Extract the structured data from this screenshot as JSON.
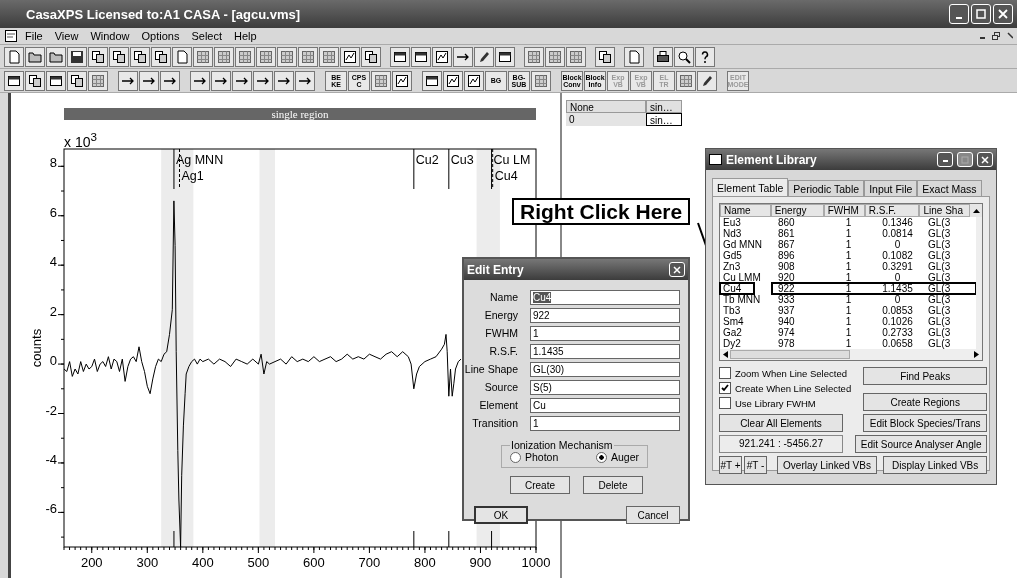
{
  "window": {
    "title": "CasaXPS Licensed to:A1 CASA - [agcu.vms]"
  },
  "menu": [
    "File",
    "View",
    "Window",
    "Options",
    "Select",
    "Help"
  ],
  "toolbar_2": [
    {
      "kind": "icon"
    },
    {
      "kind": "icon"
    },
    {
      "kind": "icon"
    },
    {
      "kind": "icon"
    },
    {
      "kind": "icon"
    },
    {
      "kind": "gap"
    },
    {
      "kind": "icon"
    },
    {
      "kind": "icon"
    },
    {
      "kind": "icon"
    },
    {
      "kind": "gap"
    },
    {
      "kind": "icon"
    },
    {
      "kind": "icon"
    },
    {
      "kind": "icon"
    },
    {
      "kind": "icon"
    },
    {
      "kind": "icon"
    },
    {
      "kind": "icon"
    },
    {
      "kind": "gap"
    },
    {
      "kind": "text",
      "label": "BE KE",
      "disabled": false
    },
    {
      "kind": "text",
      "label": "CPS C",
      "disabled": false
    },
    {
      "kind": "icon"
    },
    {
      "kind": "icon"
    },
    {
      "kind": "gap"
    },
    {
      "kind": "icon"
    },
    {
      "kind": "icon"
    },
    {
      "kind": "icon"
    },
    {
      "kind": "text",
      "label": "BG",
      "disabled": false
    },
    {
      "kind": "text",
      "label": "BG- SUB",
      "disabled": false
    },
    {
      "kind": "icon"
    },
    {
      "kind": "gap"
    },
    {
      "kind": "text",
      "label": "Block Conv",
      "disabled": false
    },
    {
      "kind": "text",
      "label": "Block Info",
      "disabled": false
    },
    {
      "kind": "text",
      "label": "Exp VB",
      "disabled": true
    },
    {
      "kind": "text",
      "label": "Exp VB",
      "disabled": true
    },
    {
      "kind": "text",
      "label": "EL TR",
      "disabled": true
    },
    {
      "kind": "icon"
    },
    {
      "kind": "icon"
    },
    {
      "kind": "gap"
    },
    {
      "kind": "text",
      "label": "EDIT MODE",
      "disabled": true
    }
  ],
  "plot": {
    "banner": "single region",
    "scale_label": "x 10$^{3}$",
    "chart_data": {
      "type": "line",
      "ylabel": "counts",
      "xlim": [
        150,
        1000
      ],
      "ylim": [
        -7.4,
        8.7
      ],
      "xticks": [
        200,
        300,
        400,
        500,
        600,
        700,
        800,
        900,
        1000
      ],
      "yticks": [
        8,
        6,
        4,
        2,
        0,
        -2,
        -4,
        -6
      ],
      "x": [
        150,
        155,
        160,
        165,
        170,
        175,
        180,
        185,
        190,
        195,
        200,
        205,
        210,
        215,
        220,
        225,
        230,
        235,
        240,
        245,
        250,
        255,
        260,
        265,
        270,
        275,
        280,
        285,
        290,
        295,
        300,
        305,
        310,
        315,
        320,
        325,
        330,
        335,
        340,
        345,
        348,
        350,
        352,
        355,
        357,
        360,
        362,
        365,
        368,
        370,
        375,
        380,
        385,
        390,
        395,
        400,
        410,
        420,
        430,
        440,
        450,
        460,
        470,
        480,
        490,
        500,
        505,
        510,
        515,
        520,
        530,
        540,
        550,
        560,
        570,
        580,
        590,
        600,
        610,
        620,
        630,
        640,
        650,
        660,
        670,
        680,
        690,
        700,
        710,
        720,
        730,
        740,
        750,
        760,
        770,
        775,
        780,
        785,
        790,
        800,
        810,
        820,
        830,
        835,
        838,
        840,
        843,
        846,
        849,
        852,
        855,
        860,
        865
      ],
      "series": [
        {
          "color": "#000000",
          "values": [
            -0.2,
            -0.3,
            0.1,
            -0.5,
            -0.2,
            -0.4,
            0.1,
            -0.3,
            0,
            -0.2,
            -0.1,
            0.2,
            -0.3,
            0,
            0.1,
            -0.1,
            0.3,
            -0.2,
            0.2,
            0.1,
            -0.3,
            0.2,
            -0.7,
            -0.1,
            0.2,
            0.3,
            0.1,
            0.7,
            0.1,
            -0.3,
            -0.9,
            -1.2,
            -0.6,
            -0.1,
            0.2,
            0.1,
            0.4,
            0.5,
            1.2,
            2.2,
            6.6,
            4.8,
            0.5,
            -3.5,
            -5.5,
            -7.4,
            -4.5,
            -2.5,
            -1.2,
            -0.4,
            -0.1,
            0.1,
            0.2,
            0,
            0.2,
            0.1,
            0.2,
            0,
            0.2,
            0.1,
            -0.1,
            0.2,
            0.1,
            0,
            0.2,
            0,
            0.4,
            -0.4,
            0.1,
            0,
            0.1,
            0.2,
            0,
            0.3,
            0.1,
            0.2,
            0.1,
            0.3,
            0.1,
            0.2,
            0.3,
            0.1,
            0.2,
            0.4,
            0.2,
            0.3,
            0.2,
            0.4,
            0.3,
            0.2,
            0.4,
            0.5,
            0.3,
            0.5,
            0.3,
            0,
            -1,
            -0.4,
            -0.1,
            0.1,
            0.2,
            0.3,
            0.6,
            0.8,
            1.2,
            0.5,
            -1.3,
            -0.2,
            -1.3,
            -0.8,
            -0.2,
            0.1,
            0.2
          ]
        }
      ],
      "ref_lines": [
        {
          "axis": "x",
          "value": 348,
          "label": "Ag MNN"
        },
        {
          "axis": "x",
          "value": 358,
          "label": "Ag1"
        },
        {
          "axis": "x",
          "value": 780,
          "label": "Cu2"
        },
        {
          "axis": "x",
          "value": 843,
          "label": "Cu3"
        },
        {
          "axis": "x",
          "value": 920,
          "label": "Cu LM"
        },
        {
          "axis": "x",
          "value": 922,
          "label": "Cu4"
        }
      ]
    }
  },
  "region_table": {
    "columns": [
      "None",
      "sin…"
    ],
    "rows": [
      {
        "cells": [
          {
            "text": "0",
            "focused": false
          },
          {
            "text": "sin…",
            "focused": true
          }
        ]
      }
    ]
  },
  "annotation": {
    "text": "Right Click Here"
  },
  "element_library": {
    "title": "Element Library",
    "tabs": [
      {
        "label": "Element Table",
        "selected": true
      },
      {
        "label": "Periodic Table",
        "selected": false
      },
      {
        "label": "Input File",
        "selected": false
      },
      {
        "label": "Exact Mass",
        "selected": false
      }
    ],
    "columns": [
      "Name",
      "Energy",
      "FWHM",
      "R.S.F.",
      "Line Sha"
    ],
    "rows": [
      {
        "cells": [
          "Eu3",
          "860",
          "1",
          "0.1346",
          "GL(3"
        ],
        "callout": false
      },
      {
        "cells": [
          "Nd3",
          "861",
          "1",
          "0.0814",
          "GL(3"
        ],
        "callout": false
      },
      {
        "cells": [
          "Gd MNN",
          "867",
          "1",
          "0",
          "GL(3"
        ],
        "callout": false
      },
      {
        "cells": [
          "Gd5",
          "896",
          "1",
          "0.1082",
          "GL(3"
        ],
        "callout": false
      },
      {
        "cells": [
          "Zn3",
          "908",
          "1",
          "0.3291",
          "GL(3"
        ],
        "callout": false
      },
      {
        "cells": [
          "Cu LMM",
          "920",
          "1",
          "0",
          "GL(3"
        ],
        "callout": false
      },
      {
        "cells": [
          "Cu4",
          "922",
          "1",
          "1.1435",
          "GL(3"
        ],
        "callout": true
      },
      {
        "cells": [
          "Tb MNN",
          "933",
          "1",
          "0",
          "GL(3"
        ],
        "callout": false
      },
      {
        "cells": [
          "Tb3",
          "937",
          "1",
          "0.0853",
          "GL(3"
        ],
        "callout": false
      },
      {
        "cells": [
          "Sm4",
          "940",
          "1",
          "0.1026",
          "GL(3"
        ],
        "callout": false
      },
      {
        "cells": [
          "Ga2",
          "974",
          "1",
          "0.2733",
          "GL(3"
        ],
        "callout": false
      },
      {
        "cells": [
          "Dy2",
          "978",
          "1",
          "0.0658",
          "GL(3"
        ],
        "callout": false
      }
    ],
    "checkboxes": [
      {
        "label": "Zoom When Line Selected",
        "checked": false
      },
      {
        "label": "Create When Line Selected",
        "checked": true
      },
      {
        "label": "Use Library FWHM",
        "checked": false
      }
    ],
    "find_peaks": "Find Peaks",
    "create_regions": "Create Regions",
    "clear_all": "Clear All Elements",
    "edit_block": "Edit Block Species/Trans",
    "readout": "921.241 : -5456.27",
    "edit_source": "Edit Source Analyser Angle",
    "trans_plus": "#T +",
    "trans_minus": "#T -",
    "overlay": "Overlay Linked VBs",
    "display": "Display Linked VBs"
  },
  "edit_entry": {
    "title": "Edit Entry",
    "fields": [
      {
        "label": "Name",
        "value": "Cu4",
        "text_selected": true
      },
      {
        "label": "Energy",
        "value": "922",
        "text_selected": false
      },
      {
        "label": "FWHM",
        "value": "1",
        "text_selected": false
      },
      {
        "label": "R.S.F.",
        "value": "1.1435",
        "text_selected": false
      },
      {
        "label": "Line Shape",
        "value": "GL(30)",
        "text_selected": false
      },
      {
        "label": "Source",
        "value": "S(5)",
        "text_selected": false
      },
      {
        "label": "Element",
        "value": "Cu",
        "text_selected": false
      },
      {
        "label": "Transition",
        "value": "1",
        "text_selected": false
      }
    ],
    "group": {
      "title": "Ionization Mechanism",
      "options": [
        {
          "label": "Photon",
          "selected": false
        },
        {
          "label": "Auger",
          "selected": true
        }
      ]
    },
    "create": "Create",
    "delete": "Delete",
    "ok": "OK",
    "cancel": "Cancel"
  }
}
